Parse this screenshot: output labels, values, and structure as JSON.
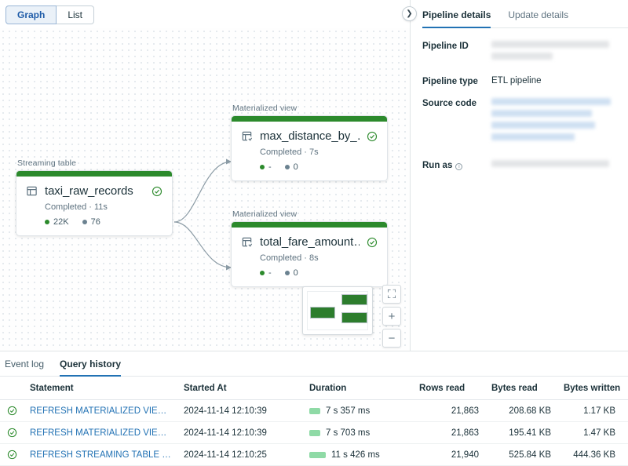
{
  "view_toggle": {
    "options": [
      "Graph",
      "List"
    ],
    "selected": "Graph"
  },
  "graph": {
    "nodes": [
      {
        "kind_label": "Streaming table",
        "name": "taxi_raw_records",
        "status": "Completed · 11s",
        "icon": "table-icon",
        "status_icon": "check-circle-icon",
        "metrics": [
          {
            "dot": "green",
            "value": "22K"
          },
          {
            "dot": "gray",
            "value": "76"
          }
        ]
      },
      {
        "kind_label": "Materialized view",
        "name": "max_distance_by_…",
        "status": "Completed · 7s",
        "icon": "materialized-view-icon",
        "status_icon": "check-circle-icon",
        "metrics": [
          {
            "dot": "green",
            "value": "-"
          },
          {
            "dot": "gray",
            "value": "0"
          }
        ]
      },
      {
        "kind_label": "Materialized view",
        "name": "total_fare_amount…",
        "status": "Completed · 8s",
        "icon": "materialized-view-icon",
        "status_icon": "check-circle-icon",
        "metrics": [
          {
            "dot": "green",
            "value": "-"
          },
          {
            "dot": "gray",
            "value": "0"
          }
        ]
      }
    ],
    "minimap": {
      "name": "minimap"
    },
    "controls": {
      "fit": "⛶",
      "zoom_in": "+",
      "zoom_out": "−"
    },
    "collapse": "❯",
    "accent_green": "#2c8a2c"
  },
  "details": {
    "tabs": [
      {
        "label": "Pipeline details",
        "active": true
      },
      {
        "label": "Update details",
        "active": false
      }
    ],
    "fields": [
      {
        "key": "Pipeline ID",
        "value": "",
        "redacted": true,
        "redacted_style": "gray",
        "lines": 2
      },
      {
        "key": "Pipeline type",
        "value": "ETL pipeline",
        "redacted": false
      },
      {
        "key": "Source code",
        "value": "",
        "redacted": true,
        "redacted_style": "blue",
        "lines": 4
      },
      {
        "key": "Run as",
        "value": "",
        "redacted": true,
        "redacted_style": "gray",
        "lines": 1,
        "info_icon": "info-icon"
      }
    ]
  },
  "bottom": {
    "tabs": [
      {
        "label": "Event log",
        "active": false
      },
      {
        "label": "Query history",
        "active": true
      }
    ],
    "columns": [
      "Statement",
      "Started At",
      "Duration",
      "Rows read",
      "Bytes read",
      "Bytes written"
    ],
    "rows": [
      {
        "status_icon": "check-circle-icon",
        "statement": "REFRESH MATERIALIZED VIEW max_di...",
        "started_at": "2024-11-14 12:10:39",
        "duration": "7 s 357 ms",
        "duration_bar_width": 14,
        "rows_read": "21,863",
        "bytes_read": "208.68 KB",
        "bytes_written": "1.17 KB"
      },
      {
        "status_icon": "check-circle-icon",
        "statement": "REFRESH MATERIALIZED VIEW total_fa...",
        "started_at": "2024-11-14 12:10:39",
        "duration": "7 s 703 ms",
        "duration_bar_width": 14,
        "rows_read": "21,863",
        "bytes_read": "195.41 KB",
        "bytes_written": "1.47 KB"
      },
      {
        "status_icon": "check-circle-icon",
        "statement": "REFRESH STREAMING TABLE taxi_raw...",
        "started_at": "2024-11-14 12:10:25",
        "duration": "11 s 426 ms",
        "duration_bar_width": 21,
        "rows_read": "21,940",
        "bytes_read": "525.84 KB",
        "bytes_written": "444.36 KB"
      }
    ]
  }
}
